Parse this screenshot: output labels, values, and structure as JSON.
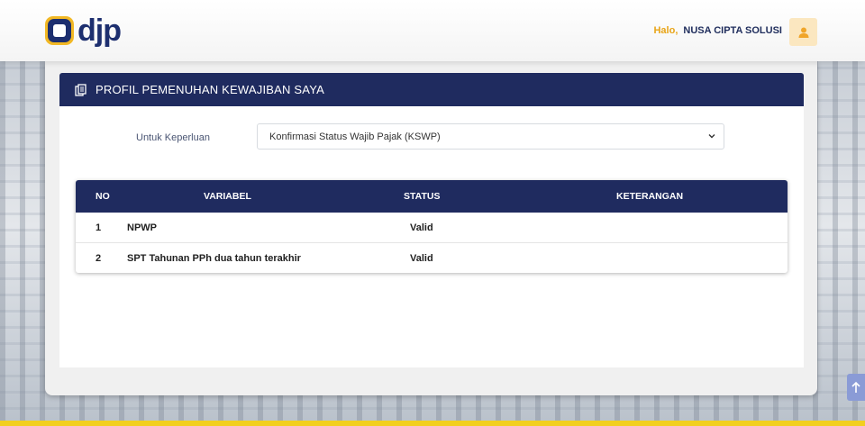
{
  "header": {
    "logo_text": "djp",
    "greeting": "Halo,",
    "user_name": "NUSA CIPTA SOLUSI"
  },
  "panel": {
    "title": "PROFIL PEMENUHAN KEWAJIBAN SAYA",
    "purpose_label": "Untuk Keperluan",
    "purpose_value": "Konfirmasi Status Wajib Pajak (KSWP)"
  },
  "table": {
    "columns": [
      "NO",
      "VARIABEL",
      "STATUS",
      "KETERANGAN"
    ],
    "rows": [
      {
        "no": "1",
        "variabel": "NPWP",
        "status": "Valid",
        "keterangan": ""
      },
      {
        "no": "2",
        "variabel": "SPT Tahunan PPh dua tahun terakhir",
        "status": "Valid",
        "keterangan": ""
      }
    ]
  },
  "colors": {
    "navy": "#1f2b5f",
    "accent_yellow": "#f2b824",
    "greeting_orange": "#e8a417"
  },
  "icons": {
    "logo": "djp-logo-icon",
    "avatar": "user-icon",
    "panel": "document-icon",
    "select": "chevron-down-icon",
    "scroll": "arrow-up-icon"
  }
}
